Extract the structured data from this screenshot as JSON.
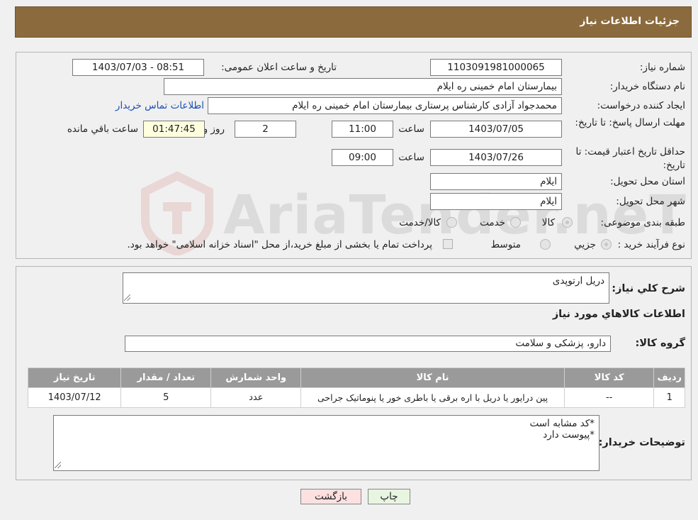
{
  "header": {
    "title": "جزئیات اطلاعات نیاز"
  },
  "form": {
    "need_number_label": "شماره نیاز:",
    "need_number": "1103091981000065",
    "announce_label": "تاریخ و ساعت اعلان عمومی:",
    "announce_value": "1403/07/03 - 08:51",
    "buyer_label": "نام دستگاه خریدار:",
    "buyer_value": "بیمارستان امام خمینی  ره  ایلام",
    "creator_label": "ایجاد کننده درخواست:",
    "creator_value": "محمدجواد آزادی کارشناس پرستاری بیمارستان امام خمینی  ره  ایلام",
    "contact_link": "اطلاعات تماس خریدار",
    "deadline_label": "مهلت ارسال پاسخ: تا تاریخ:",
    "deadline_date": "1403/07/05",
    "time_label": "ساعت",
    "deadline_time": "11:00",
    "days_value": "2",
    "days_label": "روز و",
    "remaining_time": "01:47:45",
    "remaining_label": "ساعت باقي مانده",
    "validity_label": "حداقل تاریخ اعتبار قیمت: تا تاریخ:",
    "validity_date": "1403/07/26",
    "validity_time": "09:00",
    "province_label": "استان محل تحویل:",
    "province_value": "ایلام",
    "city_label": "شهر محل تحویل:",
    "city_value": "ایلام",
    "category_label": "طبقه بندی موضوعی:",
    "category_options": [
      "کالا",
      "خدمت",
      "کالا/خدمت"
    ],
    "purchase_label": "نوع فرآیند خرید :",
    "purchase_options": [
      "جزيي",
      "متوسط"
    ],
    "payment_note": "پرداخت تمام یا بخشی از مبلغ خرید،از محل \"اسناد خزانه اسلامی\" خواهد بود."
  },
  "details": {
    "summary_label": "شرح کلي نياز:",
    "summary_value": "دریل ارتوپدی",
    "goods_info_title": "اطلاعات كالاهاي مورد نياز",
    "group_label": "گروه کالا:",
    "group_value": "دارو، پزشکی و سلامت",
    "table": {
      "headers": [
        "رديف",
        "كد كالا",
        "نام كالا",
        "واحد شمارش",
        "تعداد / مقدار",
        "تاريخ نياز"
      ],
      "rows": [
        [
          "1",
          "--",
          "پین درایور یا دریل با اره برقی یا باطری خور یا پنوماتیک جراحی",
          "عدد",
          "5",
          "1403/07/12"
        ]
      ]
    },
    "notes_label": "توضیحات خریدار:",
    "notes_value": "*کد مشابه است\n*پیوست دارد"
  },
  "buttons": {
    "print": "چاپ",
    "back": "بازگشت"
  },
  "watermark": {
    "text": "AriaTender.neT"
  },
  "colors": {
    "header": "#8b6a3e",
    "table_header": "#9a9a9a",
    "back_button": "#fde0e0",
    "print_button": "#e8f5e0",
    "link": "#1a4fb3"
  }
}
